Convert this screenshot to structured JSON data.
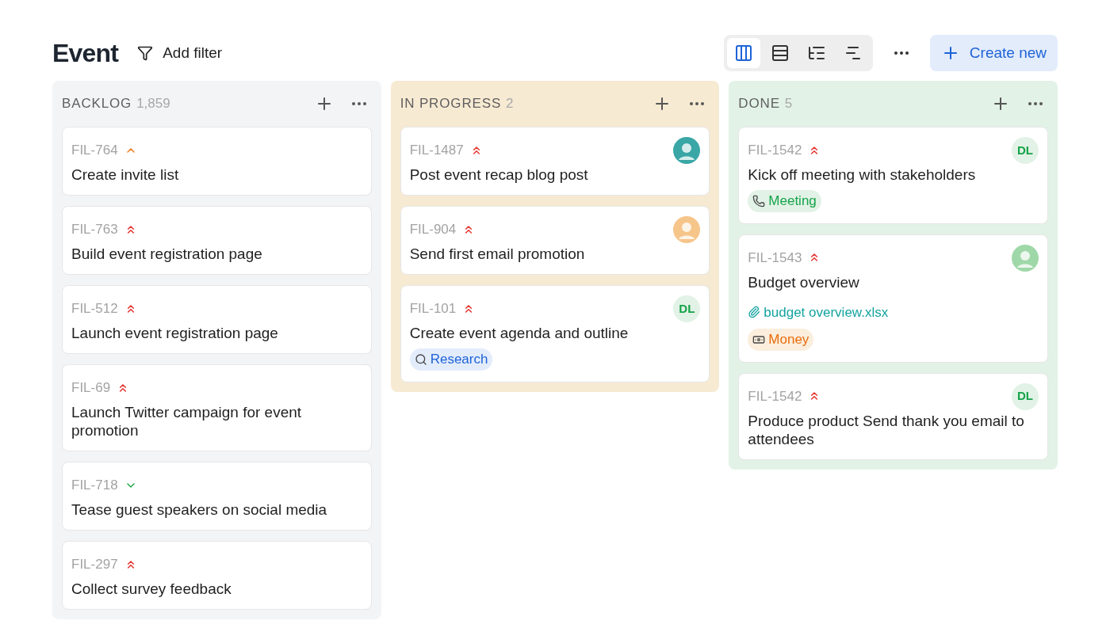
{
  "header": {
    "title": "Event",
    "filter_label": "Add filter",
    "views": [
      {
        "kind": "board",
        "selected": true
      },
      {
        "kind": "list",
        "selected": false
      },
      {
        "kind": "tree",
        "selected": false
      },
      {
        "kind": "timeline",
        "selected": false
      }
    ],
    "create_label": "Create new"
  },
  "columns": [
    {
      "name": "BACKLOG",
      "count": "1,859",
      "color": "#f3f4f6",
      "cards": [
        {
          "id": "FIL-764",
          "priority": {
            "kind": "medium"
          },
          "title": "Create invite list"
        },
        {
          "id": "FIL-763",
          "priority": {
            "kind": "high"
          },
          "title": "Build event registration page"
        },
        {
          "id": "FIL-512",
          "priority": {
            "kind": "high"
          },
          "title": "Launch event registration page"
        },
        {
          "id": "FIL-69",
          "priority": {
            "kind": "high"
          },
          "title": "Launch Twitter campaign for event promotion"
        },
        {
          "id": "FIL-718",
          "priority": {
            "kind": "low"
          },
          "title": "Tease guest speakers on social media"
        },
        {
          "id": "FIL-297",
          "priority": {
            "kind": "high"
          },
          "title": "Collect survey feedback"
        }
      ]
    },
    {
      "name": "IN PROGRESS",
      "count": "2",
      "color": "#f7ead3",
      "cards": [
        {
          "id": "FIL-1487",
          "priority": {
            "kind": "high"
          },
          "title": "Post event recap blog post",
          "avatar": {
            "kind": "photo",
            "color": "#3aa6a6"
          }
        },
        {
          "id": "FIL-904",
          "priority": {
            "kind": "high"
          },
          "title": "Send first email promotion",
          "avatar": {
            "kind": "photo",
            "color": "#f6c58a"
          }
        },
        {
          "id": "FIL-101",
          "priority": {
            "kind": "high"
          },
          "title": "Create event agenda and outline",
          "avatar": {
            "kind": "initials",
            "initials": "DL"
          },
          "tags": [
            {
              "kind": "research",
              "label": "Research",
              "color": "#1d63d8"
            }
          ]
        }
      ]
    },
    {
      "name": "DONE",
      "count": "5",
      "color": "#e2f2e6",
      "cards": [
        {
          "id": "FIL-1542",
          "priority": {
            "kind": "high"
          },
          "title": "Kick off meeting with stakeholders",
          "avatar": {
            "kind": "initials",
            "initials": "DL"
          },
          "tags": [
            {
              "kind": "meeting",
              "label": "Meeting",
              "color": "#16a34a"
            }
          ]
        },
        {
          "id": "FIL-1543",
          "priority": {
            "kind": "high"
          },
          "title": "Budget overview",
          "avatar": {
            "kind": "photo",
            "color": "#9fd8a8"
          },
          "attachment": "budget overview.xlsx",
          "tags": [
            {
              "kind": "money",
              "label": "Money",
              "color": "#ea6c0a"
            }
          ]
        },
        {
          "id": "FIL-1542",
          "priority": {
            "kind": "high"
          },
          "title": "Produce product Send thank you email to attendees",
          "avatar": {
            "kind": "initials",
            "initials": "DL"
          }
        }
      ]
    }
  ]
}
